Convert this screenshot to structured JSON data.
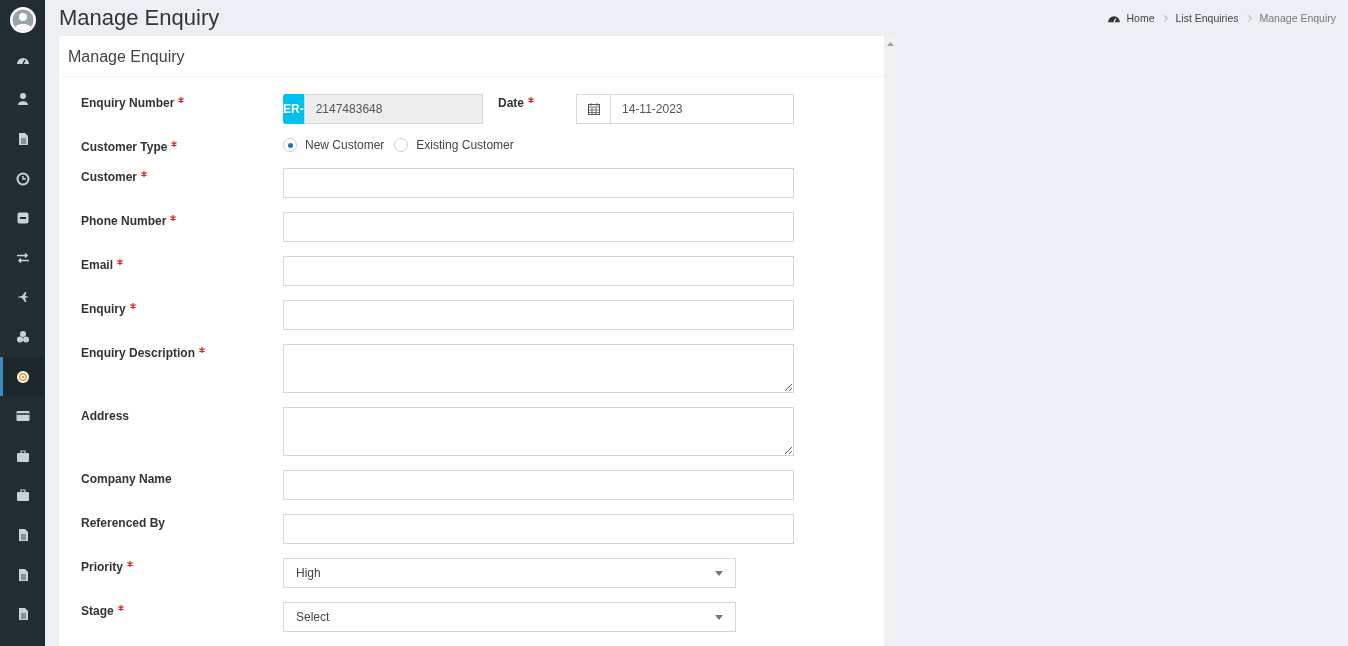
{
  "sidebar": {
    "items": [
      {
        "selected": false
      },
      {
        "selected": false
      },
      {
        "selected": false
      },
      {
        "selected": false
      },
      {
        "selected": false
      },
      {
        "selected": false
      },
      {
        "selected": false
      },
      {
        "selected": false
      },
      {
        "selected": true
      },
      {
        "selected": false
      },
      {
        "selected": false
      },
      {
        "selected": false
      },
      {
        "selected": false
      },
      {
        "selected": false
      },
      {
        "selected": false
      }
    ]
  },
  "page_title": "Manage Enquiry",
  "breadcrumb": [
    "Home",
    "List Enquiries",
    "Manage Enquiry"
  ],
  "card_title": "Manage Enquiry",
  "enquiry_number": {
    "label": "Enquiry Number",
    "required": true,
    "prefix": "ER-",
    "value": "2147483648"
  },
  "date": {
    "label": "Date",
    "required": true,
    "value": "14-11-2023"
  },
  "fields": [
    {
      "kind": "radio",
      "label": "Customer Type",
      "required": true,
      "options": [
        {
          "label": "New Customer",
          "selected": true
        },
        {
          "label": "Existing Customer",
          "selected": false
        }
      ]
    },
    {
      "kind": "input",
      "label": "Customer",
      "required": true
    },
    {
      "kind": "input",
      "label": "Phone Number",
      "required": true
    },
    {
      "kind": "input",
      "label": "Email",
      "required": true
    },
    {
      "kind": "input",
      "label": "Enquiry",
      "required": true
    },
    {
      "kind": "textarea",
      "label": "Enquiry Description",
      "required": true
    },
    {
      "kind": "textarea",
      "label": "Address",
      "required": false
    },
    {
      "kind": "input",
      "label": "Company Name",
      "required": false
    },
    {
      "kind": "input",
      "label": "Referenced By",
      "required": false
    },
    {
      "kind": "select",
      "label": "Priority",
      "required": true,
      "value": "High"
    },
    {
      "kind": "select",
      "label": "Stage",
      "required": true,
      "value": "Select"
    }
  ]
}
